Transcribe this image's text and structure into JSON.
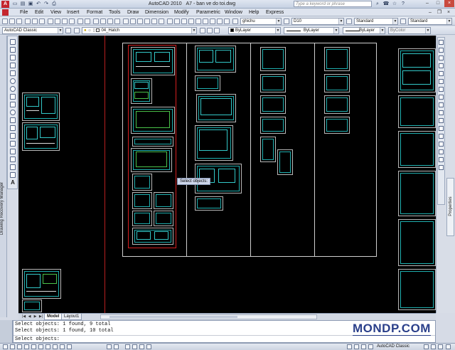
{
  "window": {
    "app_title": "AutoCAD 2010",
    "file_title": "A7 - ban ve do toi.dwg",
    "search_placeholder": "Type a keyword or phrase"
  },
  "menu": [
    "File",
    "Edit",
    "View",
    "Insert",
    "Format",
    "Tools",
    "Draw",
    "Dimension",
    "Modify",
    "Parametric",
    "Window",
    "Help",
    "Express"
  ],
  "toolbar2": {
    "text_style": "ghichu",
    "dim_style": "D10",
    "table_style": "Standard",
    "multileader_style": "Standard"
  },
  "toolbar3": {
    "workspace": "AutoCAD Classic",
    "layer": "04_Hatch",
    "color": "ByLayer",
    "linetype": "ByLayer",
    "lineweight": "ByLayer",
    "plotstyle": "ByColor"
  },
  "draw_toolbar_text_icon": "A",
  "palette": {
    "left_label": "Drawing Recovery Manager",
    "right_label": "Properties"
  },
  "canvas": {
    "tooltip": "Select objects:"
  },
  "tabs": [
    "Model",
    "Layout1"
  ],
  "command_line": {
    "history": [
      "Select objects: 1 found, 9 total",
      "Select objects: 1 found, 10 total"
    ],
    "prompt": "Select objects:"
  },
  "watermark": "MONDP.COM",
  "status": {
    "workspace": "AutoCAD Classic"
  },
  "colors": {
    "canvas": "#000000",
    "selection": "#d61f1f",
    "cyan_lines": "#33c8c8"
  }
}
